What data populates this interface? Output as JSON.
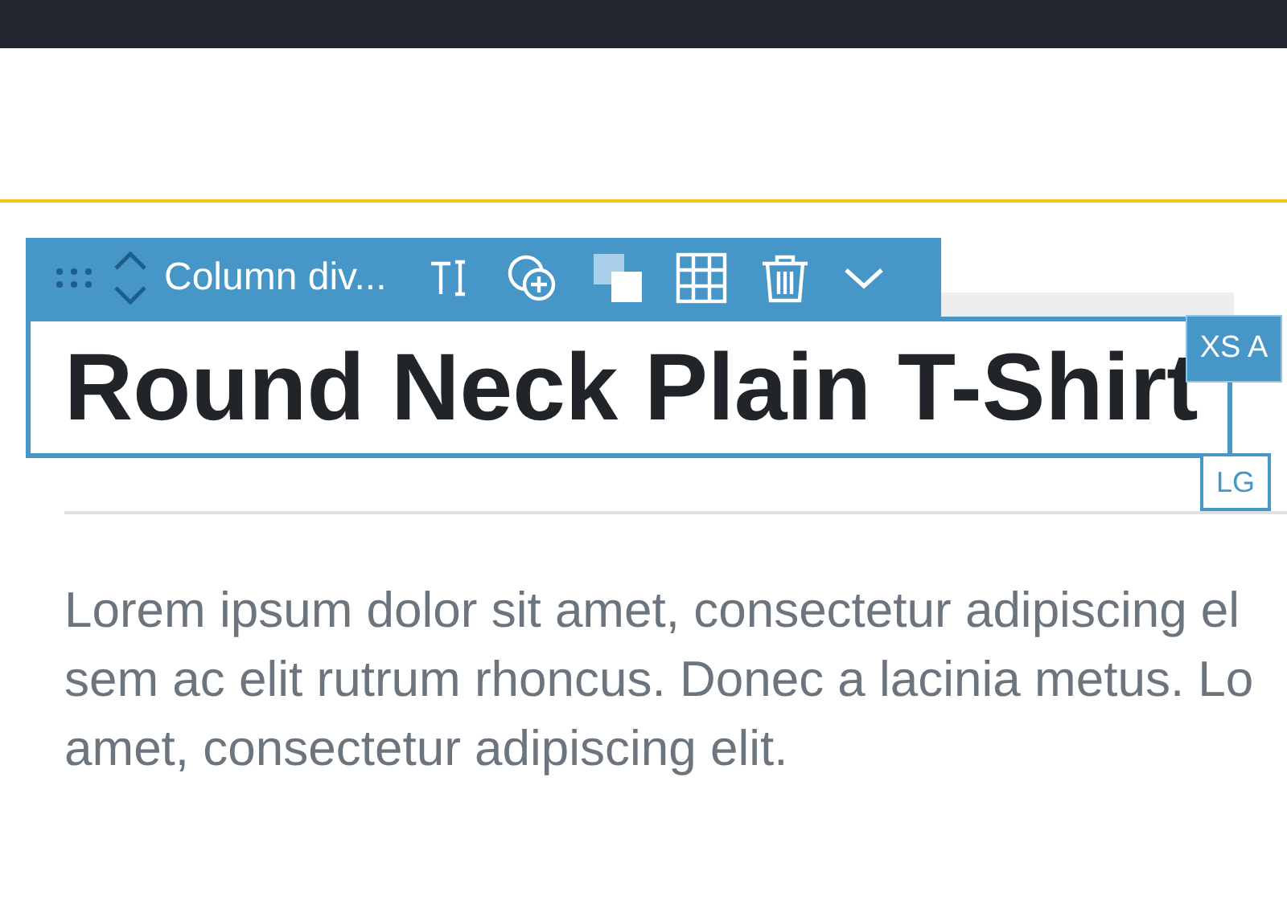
{
  "toolbar": {
    "label": "Column div...",
    "buttons": [
      {
        "kind": "text"
      },
      {
        "kind": "add"
      },
      {
        "kind": "layers"
      },
      {
        "kind": "grid"
      },
      {
        "kind": "trash"
      },
      {
        "kind": "more"
      }
    ]
  },
  "heading": "Round Neck Plain T-Shirt",
  "badges": [
    "XS A",
    "LG"
  ],
  "paragraph": [
    "Lorem ipsum dolor sit amet, consectetur adipiscing el",
    "sem ac elit rutrum rhoncus. Donec a lacinia metus. Lo",
    "amet, consectetur adipiscing elit."
  ]
}
